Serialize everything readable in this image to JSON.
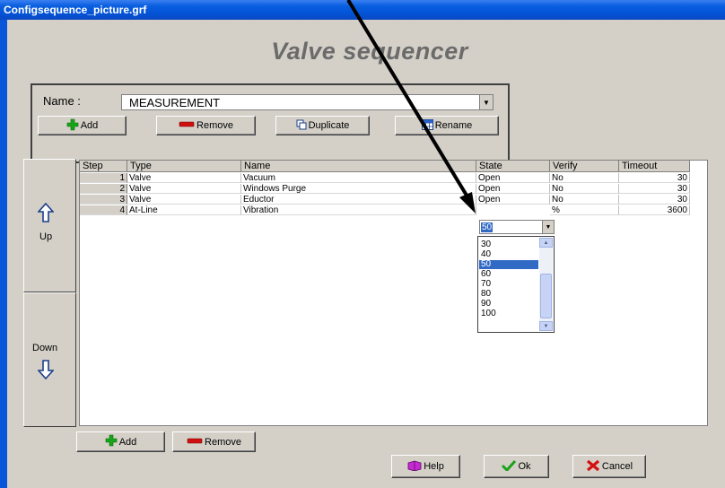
{
  "window": {
    "title": "Configsequence_picture.grf"
  },
  "heading": "Valve sequencer",
  "name_section": {
    "label": "Name :",
    "value": "MEASUREMENT",
    "buttons": {
      "add": "Add",
      "remove": "Remove",
      "duplicate": "Duplicate",
      "rename": "Rename"
    }
  },
  "side": {
    "up": "Up",
    "down": "Down"
  },
  "grid": {
    "headers": [
      "Step",
      "Type",
      "Name",
      "State",
      "Verify",
      "Timeout"
    ],
    "rows": [
      {
        "step": "1",
        "type": "Valve",
        "name": "Vacuum",
        "state": "Open",
        "verify": "No",
        "timeout": "30"
      },
      {
        "step": "2",
        "type": "Valve",
        "name": "Windows Purge",
        "state": "Open",
        "verify": "No",
        "timeout": "30"
      },
      {
        "step": "3",
        "type": "Valve",
        "name": "Eductor",
        "state": "Open",
        "verify": "No",
        "timeout": "30"
      },
      {
        "step": "4",
        "type": "At-Line",
        "name": "Vibration",
        "state": "50",
        "verify": "%",
        "timeout": "3600"
      }
    ]
  },
  "state_dropdown": {
    "value": "50",
    "options": [
      "30",
      "40",
      "50",
      "60",
      "70",
      "80",
      "90",
      "100"
    ],
    "selected": "50"
  },
  "bottom_buttons": {
    "add": "Add",
    "remove": "Remove"
  },
  "dialog_buttons": {
    "help": "Help",
    "ok": "Ok",
    "cancel": "Cancel"
  },
  "colors": {
    "titlebar": "#0352d6",
    "face": "#d4d0c8",
    "selection": "#316ac5",
    "heading": "#6b6b6b"
  },
  "icons": {
    "add": "green-plus-icon",
    "remove": "red-minus-icon",
    "duplicate": "copy-icon",
    "rename": "grid-icon",
    "up": "up-arrow-icon",
    "down": "down-arrow-icon",
    "help": "book-icon",
    "ok": "green-check-icon",
    "cancel": "red-x-icon"
  }
}
